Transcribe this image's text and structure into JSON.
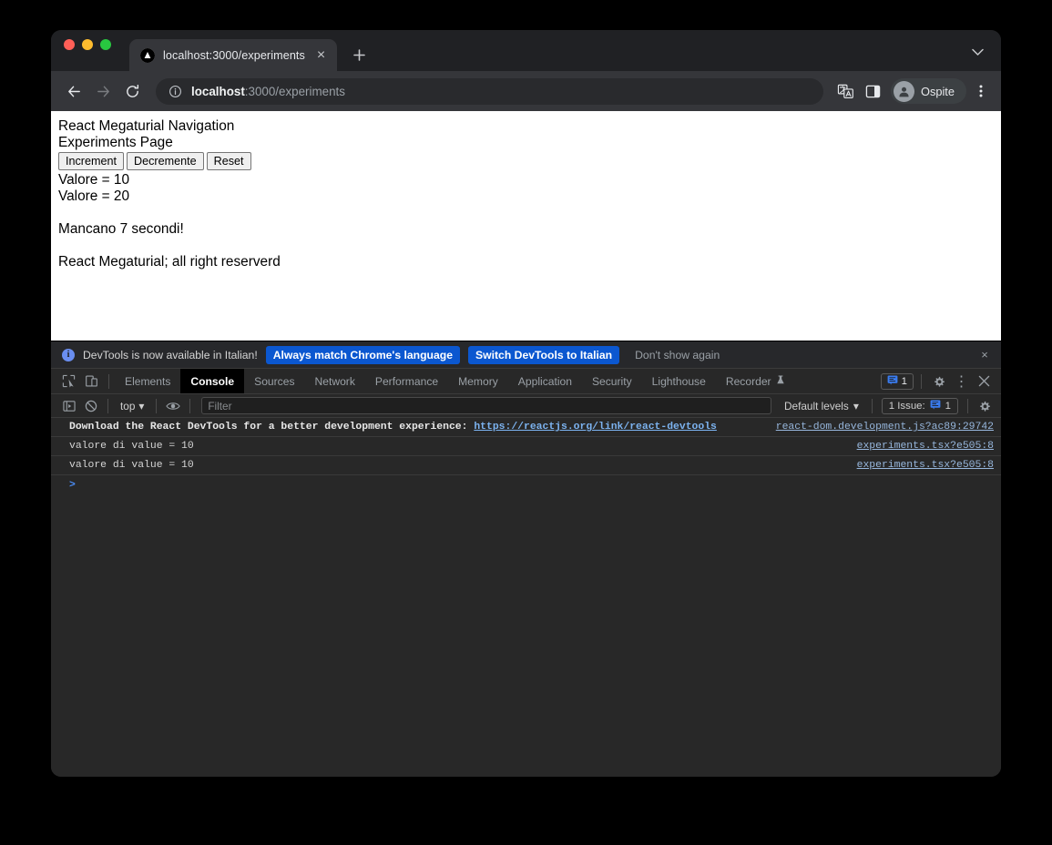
{
  "browser": {
    "tab": {
      "title": "localhost:3000/experiments",
      "favicon": "nextjs-triangle-icon",
      "close_label": "×"
    },
    "new_tab_label": "+",
    "tab_list_label": "⌄",
    "toolbar": {
      "back_label": "←",
      "forward_label": "→",
      "reload_label": "↻",
      "url_host": "localhost",
      "url_path": ":3000/experiments",
      "url_full": "localhost:3000/experiments",
      "translate_label": "translate-icon",
      "sidepanel_label": "side-panel-icon",
      "profile_name": "Ospite",
      "menu_label": "⋮"
    }
  },
  "page": {
    "heading": "React Megaturial Navigation",
    "subheading": "Experiments Page",
    "buttons": [
      {
        "label": "Increment"
      },
      {
        "label": "Decremente"
      },
      {
        "label": "Reset"
      }
    ],
    "values": [
      "Valore = 10",
      "Valore = 20"
    ],
    "countdown": "Mancano 7 secondi!",
    "footer": "React Megaturial; all right reserverd"
  },
  "devtools": {
    "banner": {
      "message": "DevTools is now available in Italian!",
      "primary_button": "Always match Chrome's language",
      "secondary_button": "Switch DevTools to Italian",
      "dismiss_button": "Don't show again",
      "close_label": "×"
    },
    "tabs": [
      {
        "label": "Elements",
        "active": false
      },
      {
        "label": "Console",
        "active": true
      },
      {
        "label": "Sources",
        "active": false
      },
      {
        "label": "Network",
        "active": false
      },
      {
        "label": "Performance",
        "active": false
      },
      {
        "label": "Memory",
        "active": false
      },
      {
        "label": "Application",
        "active": false
      },
      {
        "label": "Security",
        "active": false
      },
      {
        "label": "Lighthouse",
        "active": false
      },
      {
        "label": "Recorder",
        "active": false,
        "icon": "flask-icon"
      }
    ],
    "tabbar": {
      "inspect_label": "inspect-element-icon",
      "device_label": "device-toolbar-icon",
      "issues_count": "1",
      "settings_label": "gear-icon",
      "more_label": "⋮",
      "close_label": "×"
    },
    "filterbar": {
      "sidebar_label": "console-sidebar-icon",
      "clear_label": "clear-console-icon",
      "context": "top",
      "context_caret": "▾",
      "eye_label": "live-expression-icon",
      "filter_placeholder": "Filter",
      "levels": "Default levels",
      "levels_caret": "▾",
      "issues_label": "1 Issue:",
      "issues_count": "1",
      "settings_label": "gear-icon"
    },
    "console": {
      "prompt": ">",
      "rows": [
        {
          "text_before": "Download the React DevTools for a better development experience: ",
          "link": "https://reactjs.org/link/react-devtools",
          "source": "react-dom.development.js?ac89:29742",
          "bold": true
        },
        {
          "text_before": "valore di value = 10",
          "link": "",
          "source": "experiments.tsx?e505:8",
          "bold": false
        },
        {
          "text_before": "valore di value = 10",
          "link": "",
          "source": "experiments.tsx?e505:8",
          "bold": false
        }
      ]
    }
  },
  "colors": {
    "accent_blue": "#0b57d0",
    "link_blue": "#7cb3f0",
    "devtools_bg": "#282828",
    "chrome_bg": "#35363a",
    "page_bg": "#ffffff"
  }
}
